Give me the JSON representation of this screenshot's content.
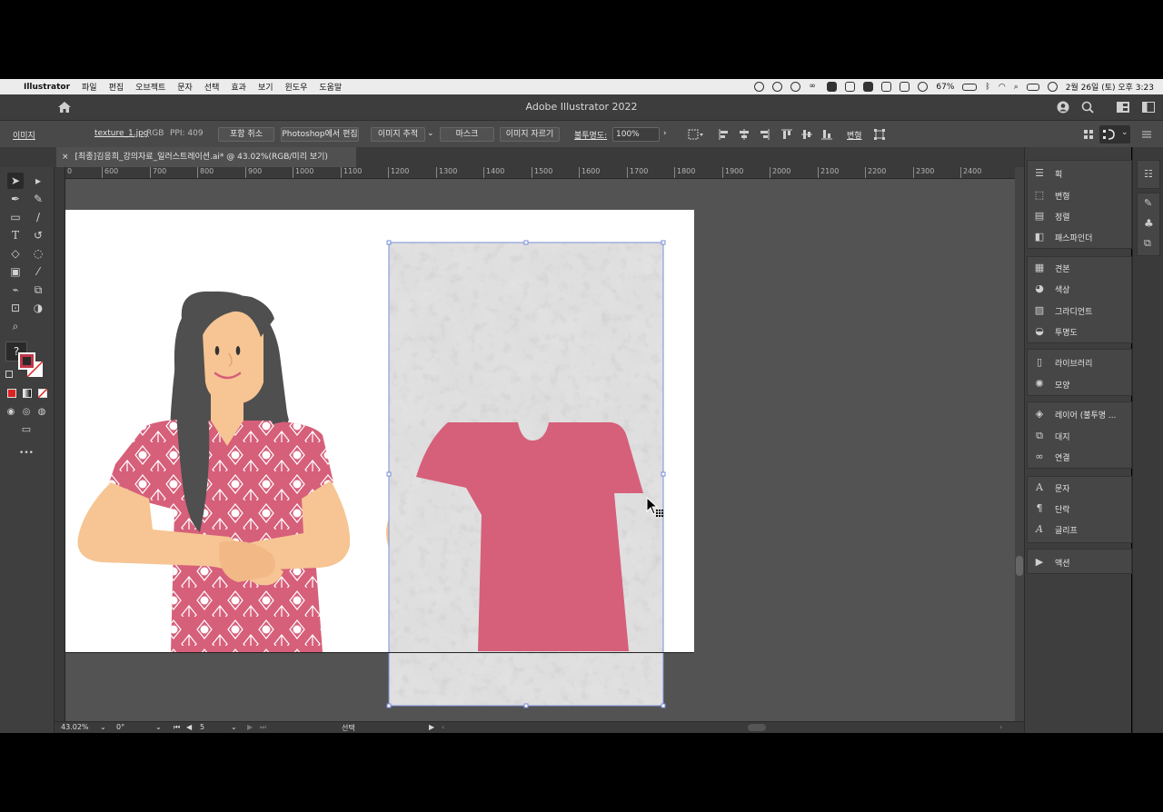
{
  "menubar": {
    "app_name": "Illustrator",
    "items": [
      "파일",
      "편집",
      "오브젝트",
      "문자",
      "선택",
      "효과",
      "보기",
      "윈도우",
      "도움말"
    ],
    "battery": "67%",
    "datetime": "2월 26일 (토) 오후 3:23"
  },
  "window": {
    "title": "Adobe Illustrator 2022"
  },
  "control_bar": {
    "selection_type": "이미지",
    "file_name": "texture_1.jpg",
    "color_mode": "RGB",
    "ppi": "PPI: 409",
    "embed_button": "포함 취소",
    "photoshop_button": "Photoshop에서 편집",
    "trace_button": "이미지 추적",
    "mask_button": "마스크",
    "crop_button": "이미지 자르기",
    "opacity_label": "불투명도:",
    "opacity_value": "100%",
    "transform_label": "변형"
  },
  "document": {
    "tab_title": "[최종]김응희_강의자료_일러스트레이션.ai* @ 43.02%(RGB/미리 보기)",
    "close_symbol": "×"
  },
  "ruler": {
    "ticks": [
      "0",
      "600",
      "700",
      "800",
      "900",
      "1000",
      "1100",
      "1200",
      "1300",
      "1400",
      "1500",
      "1600",
      "1700",
      "1800",
      "1900",
      "2000",
      "2100",
      "2200",
      "2300",
      "2400"
    ]
  },
  "toolbox": {
    "help_symbol": "?",
    "more_symbol": "•••"
  },
  "panels": {
    "group1": [
      "획",
      "변형",
      "정렬",
      "패스파인더"
    ],
    "group2": [
      "견본",
      "색상",
      "그라디언트",
      "투명도"
    ],
    "group3": [
      "라이브러리",
      "모양"
    ],
    "group4": [
      "레이어 (불투명 ...",
      "대지",
      "연결"
    ],
    "group5": [
      "문자",
      "단락",
      "글리프"
    ],
    "group6": [
      "액션"
    ]
  },
  "status_bar": {
    "zoom": "43.02%",
    "rotation": "0°",
    "artboard_number": "5",
    "tool_name": "선택"
  },
  "colors": {
    "shirt_pink": "#d65f7a",
    "skin": "#f6c593",
    "hair": "#4d4d4d",
    "ui_dark": "#3e3e3e"
  }
}
